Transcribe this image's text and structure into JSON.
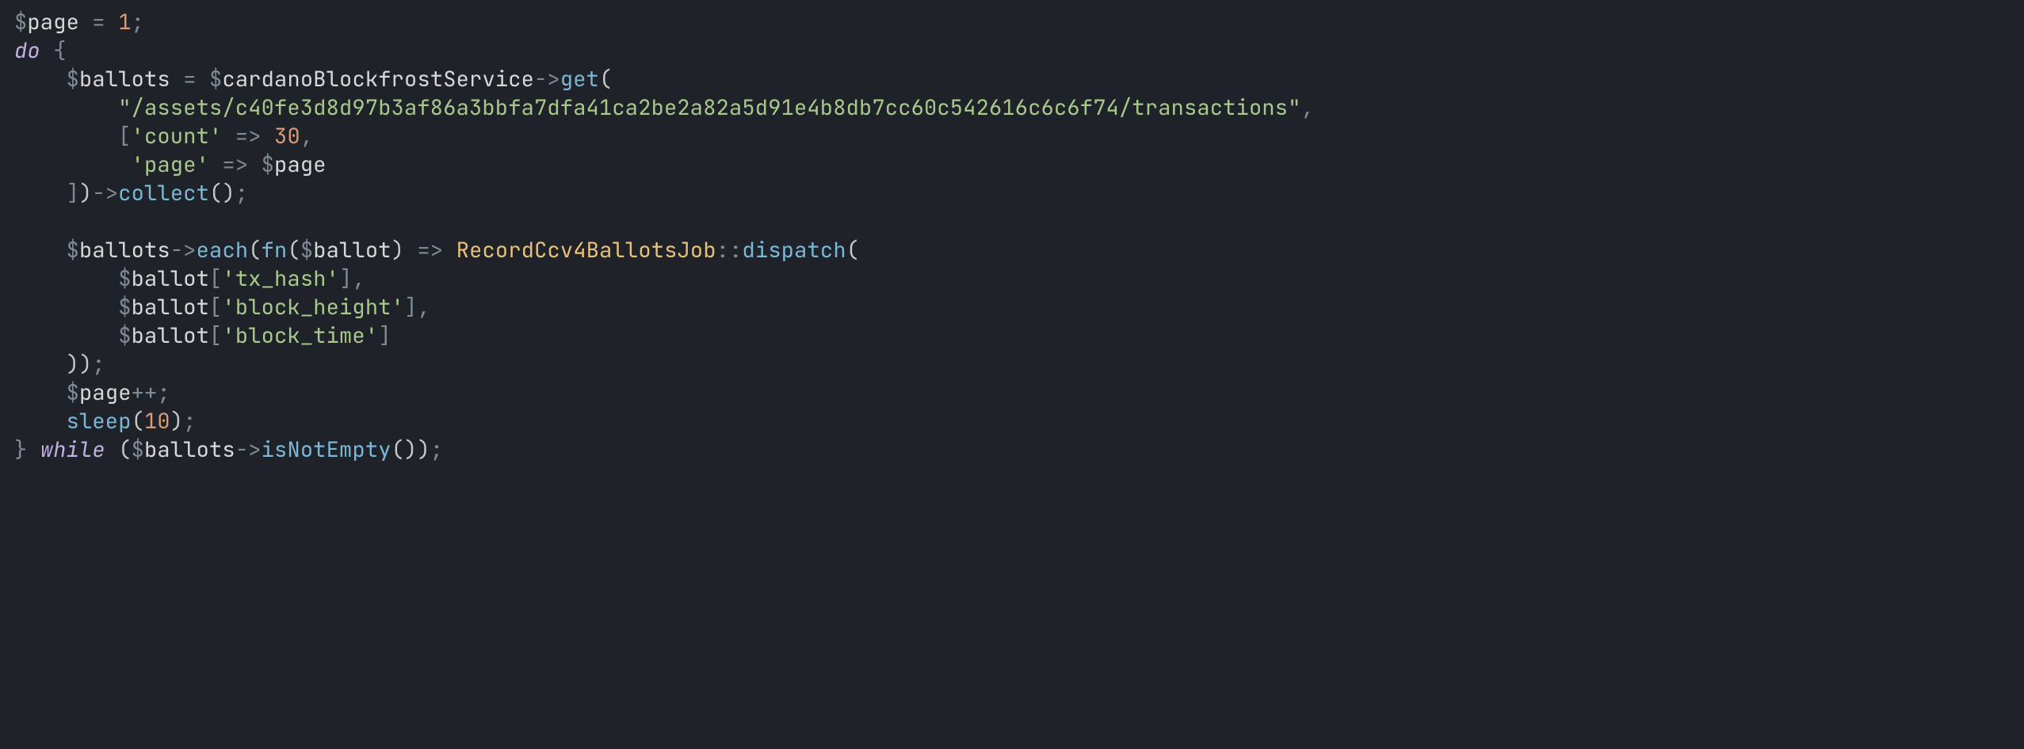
{
  "code": {
    "lines": [
      [
        {
          "cls": "tok-punct",
          "t": "$"
        },
        {
          "cls": "tok-variable",
          "t": "page"
        },
        {
          "cls": "tok-default",
          "t": " "
        },
        {
          "cls": "tok-op",
          "t": "="
        },
        {
          "cls": "tok-default",
          "t": " "
        },
        {
          "cls": "tok-number",
          "t": "1"
        },
        {
          "cls": "tok-punct",
          "t": ";"
        }
      ],
      [
        {
          "cls": "tok-keyword",
          "t": "do"
        },
        {
          "cls": "tok-default",
          "t": " "
        },
        {
          "cls": "tok-punct",
          "t": "{"
        }
      ],
      [
        {
          "cls": "tok-default",
          "t": "    "
        },
        {
          "cls": "tok-punct",
          "t": "$"
        },
        {
          "cls": "tok-variable",
          "t": "ballots"
        },
        {
          "cls": "tok-default",
          "t": " "
        },
        {
          "cls": "tok-op",
          "t": "="
        },
        {
          "cls": "tok-default",
          "t": " "
        },
        {
          "cls": "tok-punct",
          "t": "$"
        },
        {
          "cls": "tok-variable",
          "t": "cardanoBlockfrostService"
        },
        {
          "cls": "tok-op",
          "t": "->"
        },
        {
          "cls": "tok-method",
          "t": "get"
        },
        {
          "cls": "tok-paren",
          "t": "("
        }
      ],
      [
        {
          "cls": "tok-default",
          "t": "        "
        },
        {
          "cls": "tok-string",
          "t": "\"/assets/c40fe3d8d97b3af86a3bbfa7dfa41ca2be2a82a5d91e4b8db7cc60c542616c6c6f74/transactions\""
        },
        {
          "cls": "tok-punct",
          "t": ","
        }
      ],
      [
        {
          "cls": "tok-default",
          "t": "        "
        },
        {
          "cls": "tok-bracket",
          "t": "["
        },
        {
          "cls": "tok-string",
          "t": "'count'"
        },
        {
          "cls": "tok-default",
          "t": " "
        },
        {
          "cls": "tok-op",
          "t": "=>"
        },
        {
          "cls": "tok-default",
          "t": " "
        },
        {
          "cls": "tok-number",
          "t": "30"
        },
        {
          "cls": "tok-punct",
          "t": ","
        }
      ],
      [
        {
          "cls": "tok-default",
          "t": "         "
        },
        {
          "cls": "tok-string",
          "t": "'page'"
        },
        {
          "cls": "tok-default",
          "t": " "
        },
        {
          "cls": "tok-op",
          "t": "=>"
        },
        {
          "cls": "tok-default",
          "t": " "
        },
        {
          "cls": "tok-punct",
          "t": "$"
        },
        {
          "cls": "tok-variable",
          "t": "page"
        }
      ],
      [
        {
          "cls": "tok-default",
          "t": "    "
        },
        {
          "cls": "tok-bracket",
          "t": "]"
        },
        {
          "cls": "tok-paren",
          "t": ")"
        },
        {
          "cls": "tok-op",
          "t": "->"
        },
        {
          "cls": "tok-method",
          "t": "collect"
        },
        {
          "cls": "tok-paren",
          "t": "()"
        },
        {
          "cls": "tok-punct",
          "t": ";"
        }
      ],
      [
        {
          "cls": "tok-default",
          "t": ""
        }
      ],
      [
        {
          "cls": "tok-default",
          "t": "    "
        },
        {
          "cls": "tok-punct",
          "t": "$"
        },
        {
          "cls": "tok-variable",
          "t": "ballots"
        },
        {
          "cls": "tok-op",
          "t": "->"
        },
        {
          "cls": "tok-method",
          "t": "each"
        },
        {
          "cls": "tok-paren",
          "t": "("
        },
        {
          "cls": "tok-method",
          "t": "fn"
        },
        {
          "cls": "tok-paren",
          "t": "("
        },
        {
          "cls": "tok-punct",
          "t": "$"
        },
        {
          "cls": "tok-variable",
          "t": "ballot"
        },
        {
          "cls": "tok-paren",
          "t": ")"
        },
        {
          "cls": "tok-default",
          "t": " "
        },
        {
          "cls": "tok-op",
          "t": "=>"
        },
        {
          "cls": "tok-default",
          "t": " "
        },
        {
          "cls": "tok-type",
          "t": "RecordCcv4BallotsJob"
        },
        {
          "cls": "tok-op",
          "t": "::"
        },
        {
          "cls": "tok-method",
          "t": "dispatch"
        },
        {
          "cls": "tok-paren",
          "t": "("
        }
      ],
      [
        {
          "cls": "tok-default",
          "t": "        "
        },
        {
          "cls": "tok-punct",
          "t": "$"
        },
        {
          "cls": "tok-variable",
          "t": "ballot"
        },
        {
          "cls": "tok-bracket",
          "t": "["
        },
        {
          "cls": "tok-string",
          "t": "'tx_hash'"
        },
        {
          "cls": "tok-bracket",
          "t": "]"
        },
        {
          "cls": "tok-punct",
          "t": ","
        }
      ],
      [
        {
          "cls": "tok-default",
          "t": "        "
        },
        {
          "cls": "tok-punct",
          "t": "$"
        },
        {
          "cls": "tok-variable",
          "t": "ballot"
        },
        {
          "cls": "tok-bracket",
          "t": "["
        },
        {
          "cls": "tok-string",
          "t": "'block_height'"
        },
        {
          "cls": "tok-bracket",
          "t": "]"
        },
        {
          "cls": "tok-punct",
          "t": ","
        }
      ],
      [
        {
          "cls": "tok-default",
          "t": "        "
        },
        {
          "cls": "tok-punct",
          "t": "$"
        },
        {
          "cls": "tok-variable",
          "t": "ballot"
        },
        {
          "cls": "tok-bracket",
          "t": "["
        },
        {
          "cls": "tok-string",
          "t": "'block_time'"
        },
        {
          "cls": "tok-bracket",
          "t": "]"
        }
      ],
      [
        {
          "cls": "tok-default",
          "t": "    "
        },
        {
          "cls": "tok-paren",
          "t": "))"
        },
        {
          "cls": "tok-punct",
          "t": ";"
        }
      ],
      [
        {
          "cls": "tok-default",
          "t": "    "
        },
        {
          "cls": "tok-punct",
          "t": "$"
        },
        {
          "cls": "tok-variable",
          "t": "page"
        },
        {
          "cls": "tok-op",
          "t": "++"
        },
        {
          "cls": "tok-punct",
          "t": ";"
        }
      ],
      [
        {
          "cls": "tok-default",
          "t": "    "
        },
        {
          "cls": "tok-method",
          "t": "sleep"
        },
        {
          "cls": "tok-paren",
          "t": "("
        },
        {
          "cls": "tok-number",
          "t": "10"
        },
        {
          "cls": "tok-paren",
          "t": ")"
        },
        {
          "cls": "tok-punct",
          "t": ";"
        }
      ],
      [
        {
          "cls": "tok-punct",
          "t": "}"
        },
        {
          "cls": "tok-default",
          "t": " "
        },
        {
          "cls": "tok-keyword",
          "t": "while"
        },
        {
          "cls": "tok-default",
          "t": " "
        },
        {
          "cls": "tok-paren",
          "t": "("
        },
        {
          "cls": "tok-punct",
          "t": "$"
        },
        {
          "cls": "tok-variable",
          "t": "ballots"
        },
        {
          "cls": "tok-op",
          "t": "->"
        },
        {
          "cls": "tok-method",
          "t": "isNotEmpty"
        },
        {
          "cls": "tok-paren",
          "t": "())"
        },
        {
          "cls": "tok-punct",
          "t": ";"
        }
      ]
    ]
  }
}
